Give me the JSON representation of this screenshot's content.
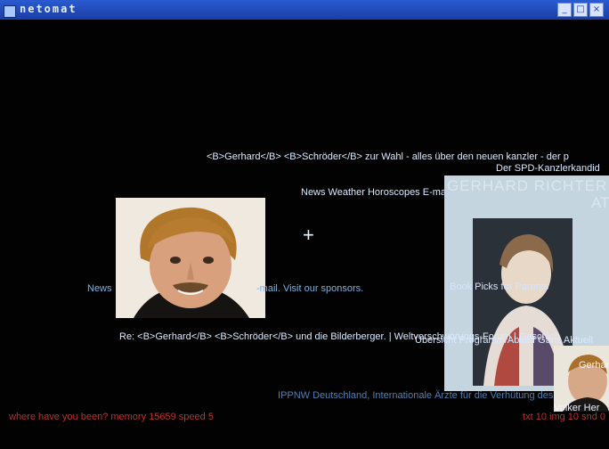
{
  "window": {
    "title": "netomat",
    "controls": [
      "_",
      "□",
      "×"
    ]
  },
  "canvas": {
    "headline_1": "<B>Gerhard</B> <B>Schröder</B> zur Wahl - alles über den neuen kanzler - der p",
    "headline_2": "Der SPD-Kanzlerkandid",
    "news_line_1": "News Weather Horoscopes E-mail. Visit our sponsors.",
    "news_line_2": "News",
    "news_line_3": "-mail. Visit our sponsors.",
    "book_picks": "Book Picks for Parents",
    "re_line": "Re: <B>Gerhard</B> <B>Schröder</B> und die Bilderberger. | Weltverschwörungs-Forum | Geschich",
    "uebersicht": "Übersicht Programm/Ablauf Ganz Aktuell",
    "ippnw": "IPPNW Deutschland, Internationale Ärzte für die Verhütung des Atom",
    "gerhard_right": "Gerhard",
    "poster_title": "GERHARD RICHTER",
    "poster_sub": "ATLAS",
    "richter_fragment": "Volker Her"
  },
  "status": {
    "left": "where have you been?    memory 15659    speed 5",
    "right": "txt 10    img 10    snd 0"
  },
  "colors": {
    "background": "#020202",
    "text": "#d9e9ff",
    "status": "#b8302b",
    "titlebar": "#1a3ea6"
  }
}
